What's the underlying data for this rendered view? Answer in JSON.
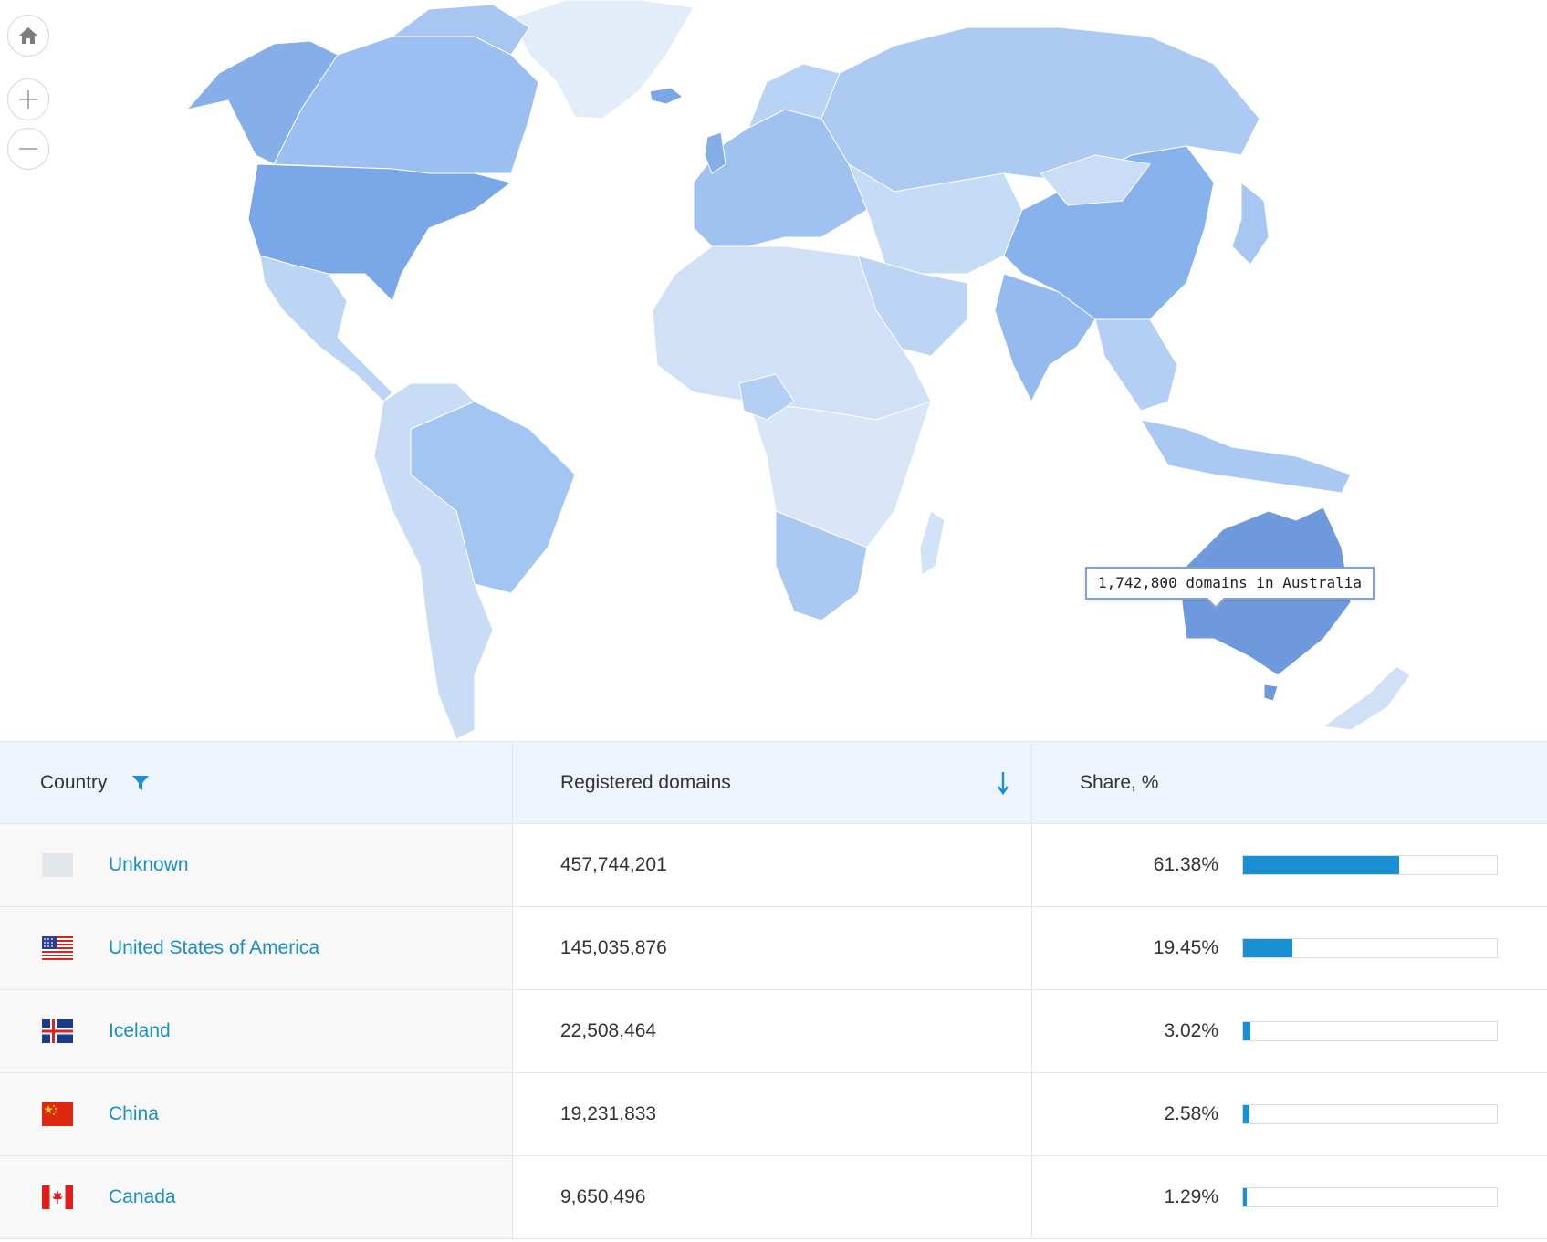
{
  "map": {
    "tooltip": "1,742,800 domains in Australia",
    "controls": {
      "home": "home-icon",
      "zoom_in": "plus-icon",
      "zoom_out": "minus-icon"
    },
    "colors": {
      "dark": "#7aa7e6",
      "mid": "#9cc0ee",
      "light": "#c4d9f5",
      "pale": "#dce9f9",
      "highlight": "#6f99dd"
    }
  },
  "table": {
    "headers": {
      "country": "Country",
      "domains": "Registered domains",
      "share": "Share, %"
    },
    "sort_icon": "arrow-down-icon",
    "filter_icon": "filter-icon",
    "rows": [
      {
        "country": "Unknown",
        "flag": "unknown",
        "domains": "457,744,201",
        "share": "61.38%",
        "share_value": 61.38
      },
      {
        "country": "United States of America",
        "flag": "us",
        "domains": "145,035,876",
        "share": "19.45%",
        "share_value": 19.45
      },
      {
        "country": "Iceland",
        "flag": "is",
        "domains": "22,508,464",
        "share": "3.02%",
        "share_value": 3.02
      },
      {
        "country": "China",
        "flag": "cn",
        "domains": "19,231,833",
        "share": "2.58%",
        "share_value": 2.58
      },
      {
        "country": "Canada",
        "flag": "ca",
        "domains": "9,650,496",
        "share": "1.29%",
        "share_value": 1.29
      }
    ]
  }
}
